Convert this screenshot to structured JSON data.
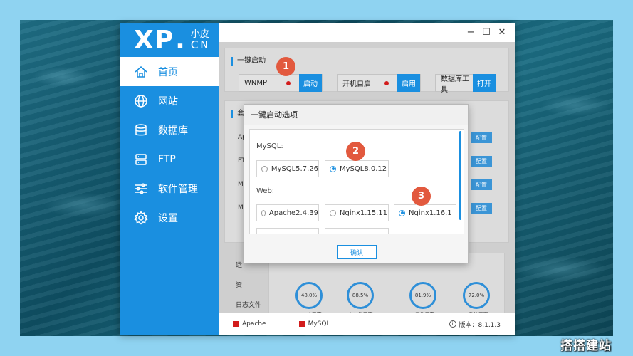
{
  "logo": {
    "xp": "XP",
    "dot": ".",
    "cn1": "小皮",
    "cn2": "CN"
  },
  "nav": [
    {
      "label": "首页",
      "icon": "home-icon"
    },
    {
      "label": "网站",
      "icon": "globe-icon"
    },
    {
      "label": "数据库",
      "icon": "database-icon"
    },
    {
      "label": "FTP",
      "icon": "server-icon"
    },
    {
      "label": "软件管理",
      "icon": "sliders-icon"
    },
    {
      "label": "设置",
      "icon": "gear-icon"
    }
  ],
  "window": {
    "minimize": "−",
    "maximize": "☐",
    "close": "✕"
  },
  "quickstart": {
    "title": "一键启动",
    "wnmp_label": "WNMP",
    "wnmp_btn": "启动",
    "boot_label": "开机自启",
    "boot_btn": "启用",
    "dbtool_label": "数据库工具",
    "dbtool_btn": "打开"
  },
  "suite": {
    "title_partial": "套",
    "rows": [
      "Ap",
      "FT",
      "M",
      "M"
    ],
    "config_btn": "配置"
  },
  "bottom": {
    "tab1": "运",
    "tab2": "资",
    "log_tab": "日志文件",
    "gauges": [
      {
        "value": "48.0%",
        "caption": "CPU使用率"
      },
      {
        "value": "88.5%",
        "caption": "内存使用率"
      },
      {
        "value": "81.9%",
        "caption": "C盘使用率"
      },
      {
        "value": "72.0%",
        "caption": "D盘使用率"
      }
    ]
  },
  "status": {
    "apache": "Apache",
    "mysql": "MySQL",
    "version": "版本：8.1.1.3",
    "status_color": "#d21c1c"
  },
  "dialog": {
    "title": "一键启动选项",
    "mysql_label": "MySQL:",
    "mysql_options": [
      {
        "label": "MySQL5.7.26",
        "checked": false
      },
      {
        "label": "MySQL8.0.12",
        "checked": true
      }
    ],
    "web_label": "Web:",
    "web_options": [
      {
        "label": "Apache2.4.39",
        "checked": false
      },
      {
        "label": "Nginx1.15.11",
        "checked": false
      },
      {
        "label": "Nginx1.16.1",
        "checked": true
      }
    ],
    "ok_btn": "确认"
  },
  "badges": [
    "1",
    "2",
    "3"
  ],
  "watermark": "搭搭建站",
  "accent_color": "#1a8fe0",
  "badge_color": "#e2593e"
}
